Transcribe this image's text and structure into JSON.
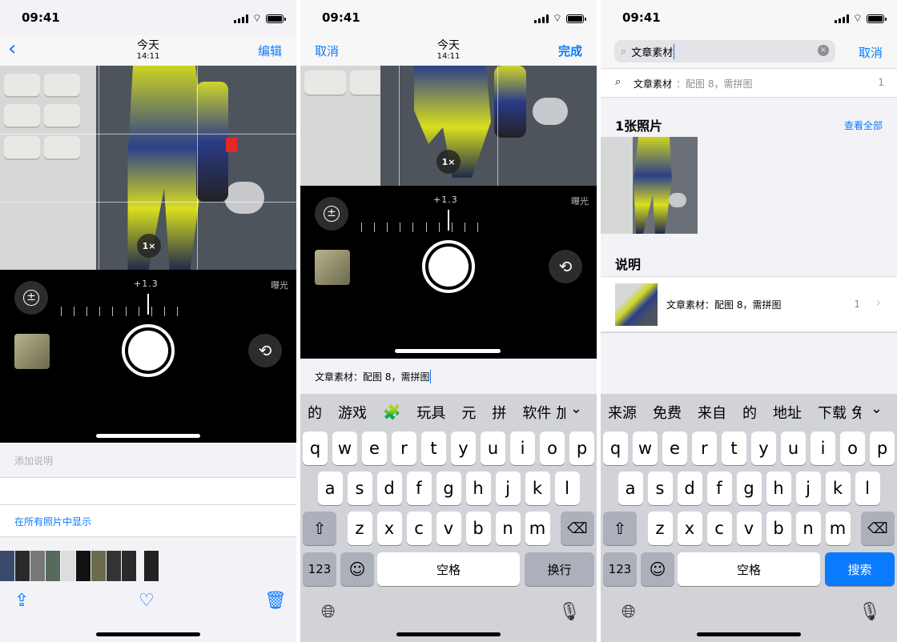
{
  "status": {
    "time": "09:41"
  },
  "screen1": {
    "back_icon": "chevron-left-icon",
    "title": "今天",
    "subtitle": "14:11",
    "edit": "编辑",
    "zoom": "1×",
    "ev": "+1.3",
    "exposure": "曝光",
    "caption_placeholder": "添加说明",
    "show_in_all": "在所有照片中显示",
    "share_icon": "share-icon",
    "like_icon": "heart-icon",
    "delete_icon": "trash-icon"
  },
  "screen2": {
    "cancel": "取消",
    "title": "今天",
    "subtitle": "14:11",
    "done": "完成",
    "zoom": "1×",
    "ev": "+1.3",
    "exposure": "曝光",
    "caption_text": "文章素材：配图 8，需拼图",
    "candidates": [
      "的",
      "游戏",
      "🧩",
      "玩具",
      "元",
      "拼",
      "软件",
      "加"
    ],
    "keyboard_switch": "123",
    "space": "空格",
    "return": "换行"
  },
  "screen3": {
    "search_text": "文章素材",
    "cancel": "取消",
    "suggestion": {
      "term": "文章素材",
      "detail": "：配图 8，需拼图",
      "count": "1"
    },
    "photos_title": "1张照片",
    "see_all": "查看全部",
    "captions_title": "说明",
    "caption_result": {
      "text": "文章素材：配图 8，需拼图",
      "count": "1"
    },
    "candidates": [
      "来源",
      "免费",
      "来自",
      "的",
      "地址",
      "下载",
      "免"
    ],
    "keyboard_switch": "123",
    "space": "空格",
    "search": "搜索"
  },
  "keyboard": {
    "row1": [
      "q",
      "w",
      "e",
      "r",
      "t",
      "y",
      "u",
      "i",
      "o",
      "p"
    ],
    "row2": [
      "a",
      "s",
      "d",
      "f",
      "g",
      "h",
      "j",
      "k",
      "l"
    ],
    "row3": [
      "z",
      "x",
      "c",
      "v",
      "b",
      "n",
      "m"
    ]
  },
  "colors": {
    "accent": "#0a7aff",
    "camera_bg": "#000000",
    "keyboard_bg": "#d1d3d9"
  }
}
